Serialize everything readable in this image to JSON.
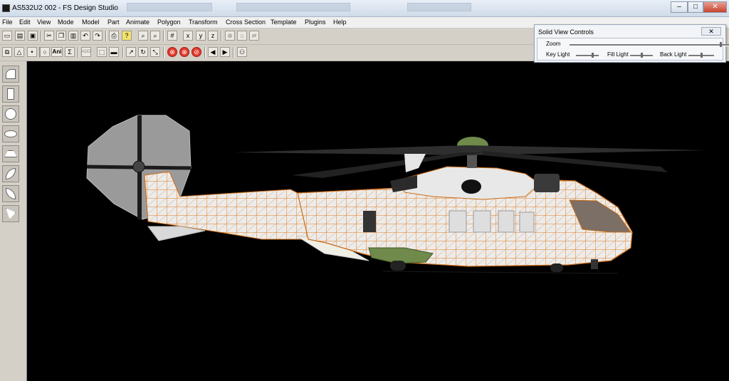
{
  "window": {
    "title": "AS532U2 002 - FS Design Studio"
  },
  "window_controls": {
    "minimize": "–",
    "maximize": "□",
    "close": "✕"
  },
  "menu": {
    "items": [
      "File",
      "Edit",
      "View",
      "Mode",
      "Model",
      "Part",
      "Animate",
      "Polygon",
      "Transform",
      "Cross Section",
      "Template",
      "Plugins",
      "Help"
    ]
  },
  "toolbar1": {
    "icons": [
      "new-icon",
      "open-icon",
      "save-icon",
      "cut-icon",
      "copy-icon",
      "paste-icon",
      "undo-icon",
      "redo-icon",
      "print-icon",
      "help-icon",
      "zoom-in-icon",
      "zoom-out-icon",
      "grid-icon",
      "flip-x-icon",
      "flip-y-icon",
      "flip-z-icon",
      "weld-icon",
      "merge-icon",
      "align-icon"
    ]
  },
  "toolbar2": {
    "ani_label": "Ani",
    "sum_label": "Σ",
    "prev_label": "◀",
    "next_label": "▶"
  },
  "left_tools": {
    "icons": [
      "panel-shape-icon",
      "tall-panel-icon",
      "circle-shape-icon",
      "ellipse-shape-icon",
      "wedge-shape-icon",
      "leaf-shape-icon",
      "leaf-shape-2-icon",
      "triangle-leaf-icon"
    ]
  },
  "solid_view_controls": {
    "title": "Solid View Controls",
    "close_label": "✕",
    "zoom_label": "Zoom",
    "key_light_label": "Key Light",
    "fill_light_label": "Fill Light",
    "back_light_label": "Back Light",
    "zoom_value": 0.95,
    "key_light_value": 0.75,
    "fill_light_value": 0.5,
    "back_light_value": 0.5
  },
  "colors": {
    "wireframe": "#e07a1a",
    "fuselage": "#e8e8e8",
    "rotor_disc": "#9a9a9a",
    "accent_green": "#6f8a4a"
  }
}
